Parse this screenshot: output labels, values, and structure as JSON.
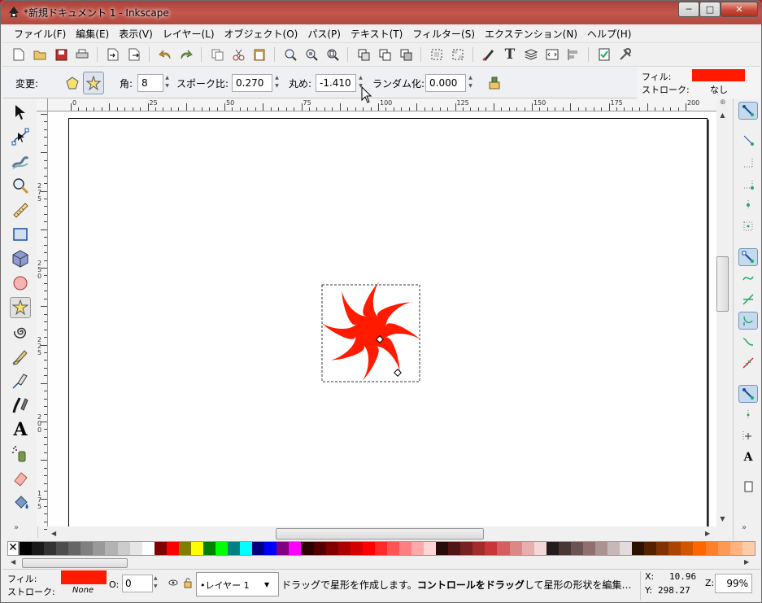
{
  "window": {
    "title": "*新規ドキュメント 1 - Inkscape",
    "min_glyph": "─",
    "max_glyph": "□",
    "close_glyph": "✕"
  },
  "menu": [
    "ファイル(F)",
    "編集(E)",
    "表示(V)",
    "レイヤー(L)",
    "オブジェクト(O)",
    "パス(P)",
    "テキスト(T)",
    "フィルター(S)",
    "エクステンション(N)",
    "ヘルプ(H)"
  ],
  "tool_controls": {
    "change_label": "変更:",
    "corners_label": "角:",
    "corners_value": "8",
    "spoke_label": "スポーク比:",
    "spoke_value": "0.270",
    "rounded_label": "丸め:",
    "rounded_value": "-1.410",
    "random_label": "ランダム化:",
    "random_value": "0.000"
  },
  "style_indicator": {
    "fill_label": "フィル:",
    "stroke_label": "ストローク:",
    "stroke_value": "なし",
    "fill_color": "#ff1a00"
  },
  "rulers": {
    "h_ticks": [
      "0",
      "25",
      "50",
      "75",
      "100",
      "125",
      "150",
      "175",
      "200"
    ],
    "v_ticks": [
      "2\n7\n5",
      "2\n5\n0",
      "2\n2\n5",
      "2\n0\n0",
      "1\n7\n5"
    ]
  },
  "colors": {
    "star_fill": "#ff1a00",
    "accent": "#1a4f9c"
  },
  "palette": [
    "#000000",
    "#1a1a1a",
    "#333333",
    "#4d4d4d",
    "#666666",
    "#808080",
    "#999999",
    "#b3b3b3",
    "#cccccc",
    "#e6e6e6",
    "#ffffff",
    "#800000",
    "#ff0000",
    "#808000",
    "#ffff00",
    "#008000",
    "#00ff00",
    "#008080",
    "#00ffff",
    "#000080",
    "#0000ff",
    "#800080",
    "#ff00ff",
    "#2b0000",
    "#550000",
    "#800000",
    "#aa0000",
    "#d40000",
    "#ff0000",
    "#ff2a2a",
    "#ff5555",
    "#ff8080",
    "#ffaaaa",
    "#ffd5d5",
    "#280b0b",
    "#501616",
    "#782121",
    "#a02c2c",
    "#c83737",
    "#d35f5f",
    "#de8787",
    "#e9afaf",
    "#f4d7d7",
    "#241c1c",
    "#483737",
    "#6c5353",
    "#916f6f",
    "#ac9393",
    "#c8b7b7",
    "#e3dbdb",
    "#2b1100",
    "#552200",
    "#803300",
    "#aa4400",
    "#d45500",
    "#ff6600",
    "#ff7f2a",
    "#ff9955",
    "#ffb380",
    "#ffccaa"
  ],
  "statusbar": {
    "fill_label": "フィル:",
    "stroke_label": "ストローク:",
    "stroke_value": "None",
    "opacity_label": "O:",
    "opacity_value": "0",
    "layer_value": "•レイヤー 1",
    "message_a": "ドラッグで星形を作成します。",
    "message_b": "コントロールをドラッグ",
    "message_c": "して星形の形状を編集…",
    "x_label": "X:",
    "x_value": "10.96",
    "y_label": "Y:",
    "y_value": "298.27",
    "zoom_label": "Z:",
    "zoom_value": "99%"
  }
}
